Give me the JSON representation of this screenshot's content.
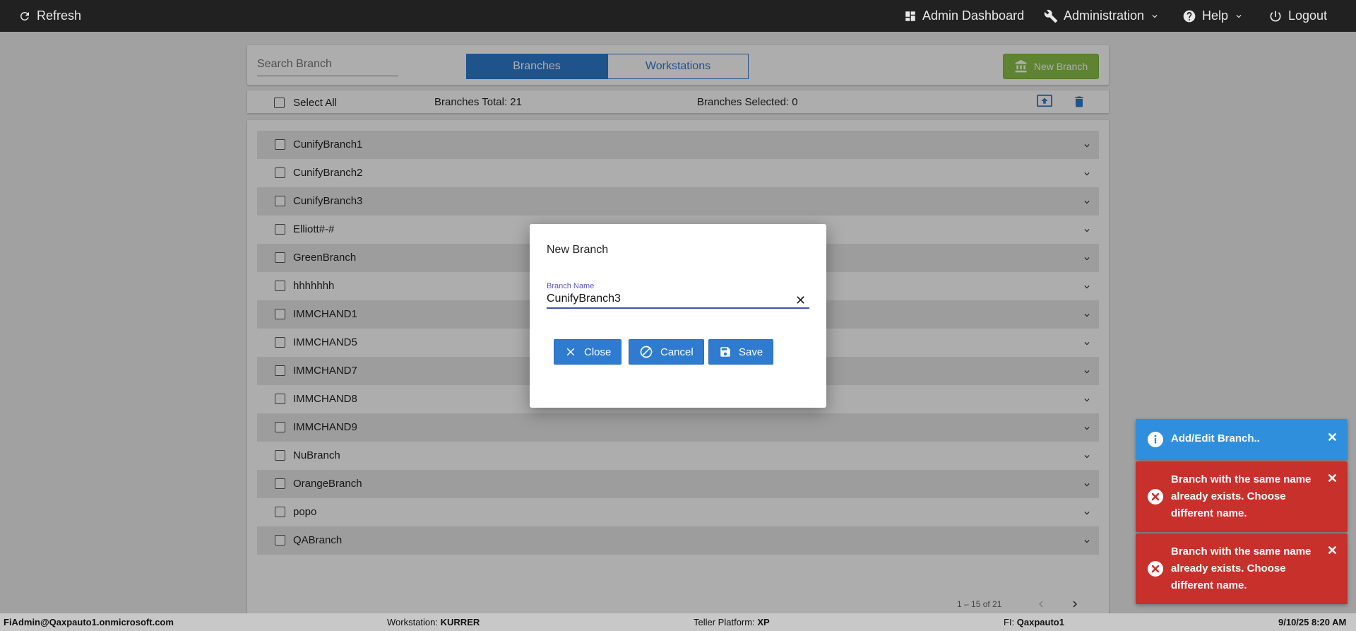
{
  "topbar": {
    "refresh": "Refresh",
    "admin_dashboard": "Admin Dashboard",
    "administration": "Administration",
    "help": "Help",
    "logout": "Logout"
  },
  "toolbar": {
    "search_placeholder": "Search Branch",
    "tab_branches": "Branches",
    "tab_workstations": "Workstations",
    "new_branch": "New Branch"
  },
  "selectbar": {
    "select_all": "Select All",
    "total": "Branches Total: 21",
    "selected": "Branches Selected: 0"
  },
  "branches": [
    "CunifyBranch1",
    "CunifyBranch2",
    "CunifyBranch3",
    "Elliott#-#",
    "GreenBranch",
    "hhhhhhh",
    "IMMCHAND1",
    "IMMCHAND5",
    "IMMCHAND7",
    "IMMCHAND8",
    "IMMCHAND9",
    "NuBranch",
    "OrangeBranch",
    "popo",
    "QABranch"
  ],
  "pager": {
    "range": "1 – 15 of 21"
  },
  "footer": {
    "user": "FiAdmin@Qaxpauto1.onmicrosoft.com",
    "workstation_label": "Workstation:",
    "workstation_value": "KURRER",
    "platform_label": "Teller Platform:",
    "platform_value": "XP",
    "fi_label": "FI:",
    "fi_value": "Qaxpauto1",
    "datetime": "9/10/25 8:20 AM"
  },
  "dialog": {
    "title": "New Branch",
    "field_label": "Branch Name",
    "field_value": "CunifyBranch3",
    "close": "Close",
    "cancel": "Cancel",
    "save": "Save"
  },
  "toasts": {
    "info": "Add/Edit Branch..",
    "error1": "Branch with the same name already exists. Choose different name.",
    "error2": "Branch with the same name already exists. Choose different name."
  },
  "colors": {
    "accent": "#2e7bcf",
    "new_branch_green": "#8bc34a",
    "toast_info": "#2f8fdc",
    "toast_error": "#c8302c"
  }
}
